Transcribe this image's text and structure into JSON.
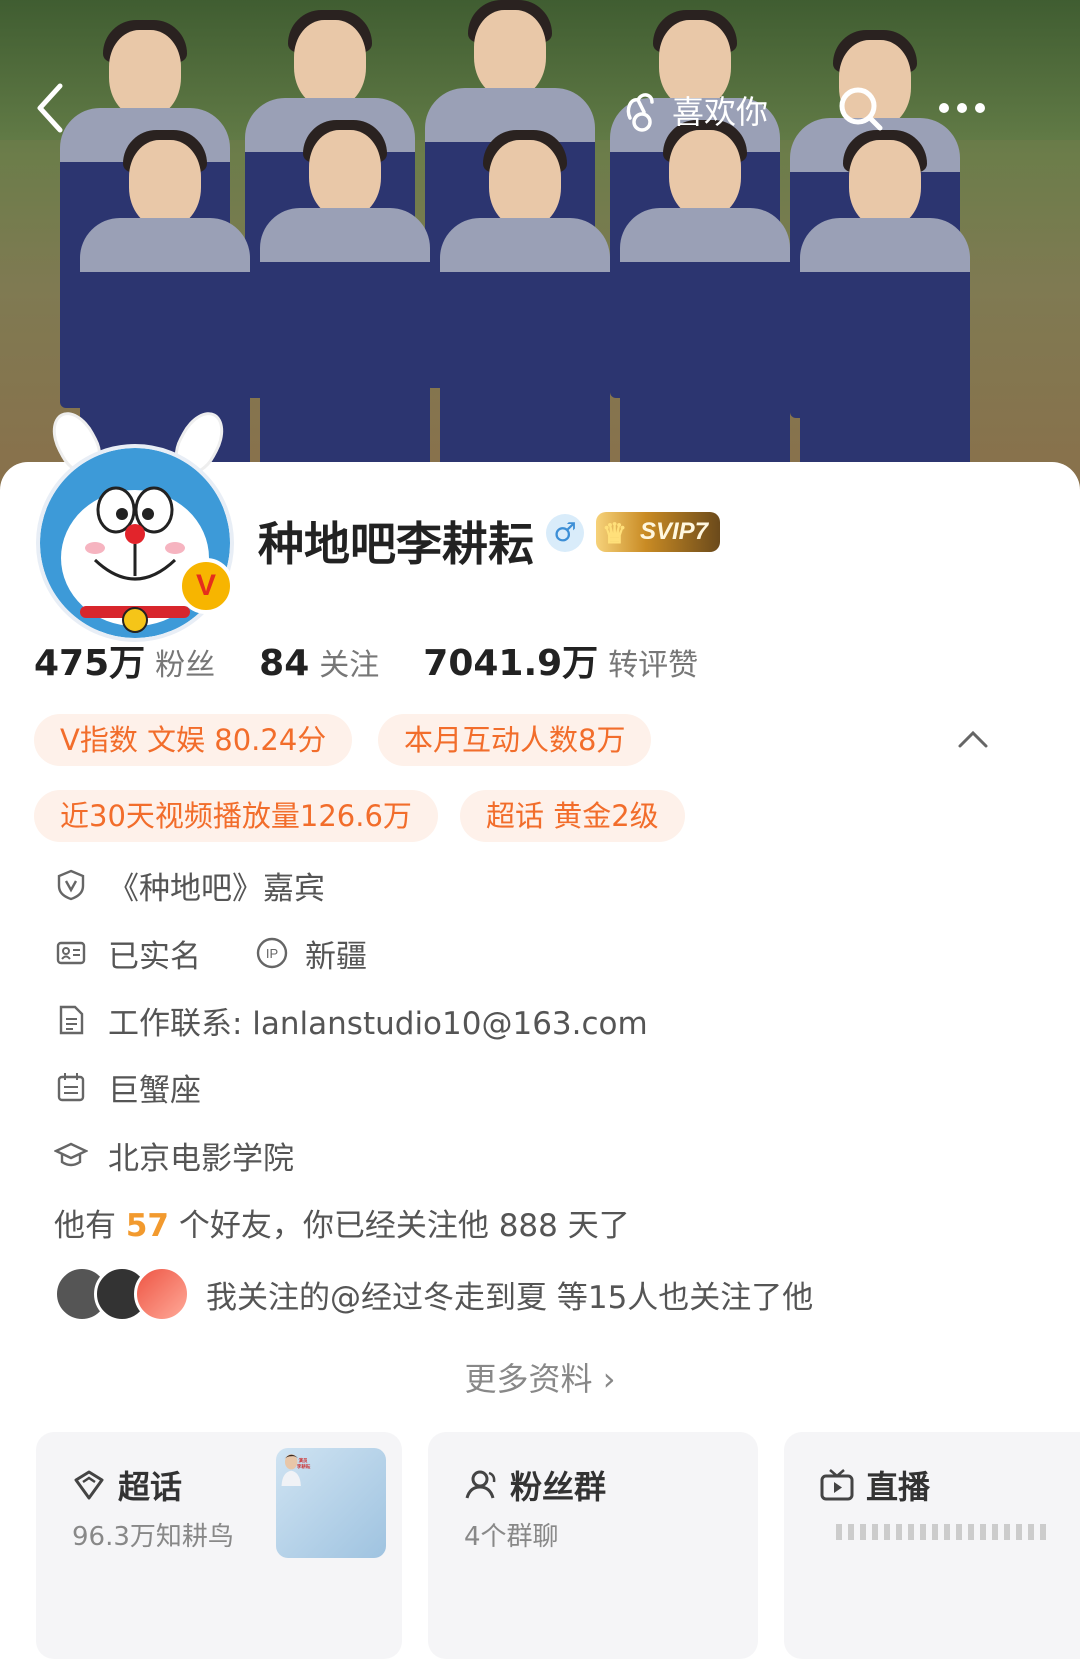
{
  "header": {
    "like_label": "喜欢你",
    "back_icon": "chevron-left-icon",
    "search_icon": "search-icon",
    "more_icon": "more-icon"
  },
  "profile": {
    "name": "种地吧李耕耘",
    "gender_symbol": "♂",
    "vip_label": "SVIP7",
    "verified_mark": "V"
  },
  "stats": [
    {
      "value": "475万",
      "label": "粉丝"
    },
    {
      "value": "84",
      "label": "关注"
    },
    {
      "value": "7041.9万",
      "label": "转评赞"
    }
  ],
  "tags": [
    "V指数 文娱 80.24分",
    "本月互动人数8万",
    "近30天视频播放量126.6万",
    "超话 黄金2级"
  ],
  "info": {
    "guest": "《种地吧》嘉宾",
    "real_name": "已实名",
    "ip_location": "新疆",
    "contact": "工作联系: lanlanstudio10@163.com",
    "zodiac": "巨蟹座",
    "school": "北京电影学院"
  },
  "friends": {
    "prefix": "他有",
    "count": "57",
    "suffix": "个好友，你已经关注他 888 天了"
  },
  "mutual": {
    "text": "我关注的@经过冬走到夏 等15人也关注了他"
  },
  "more_info": "更多资料",
  "bottom_cards": [
    {
      "title": "超话",
      "sub": "96.3万知耕鸟",
      "thumb_text": "演员\n李耕耘"
    },
    {
      "title": "粉丝群",
      "sub": "4个群聊"
    },
    {
      "title": "直播",
      "sub": ""
    }
  ],
  "colors": {
    "tag_bg": "#fef1ea",
    "tag_text": "#f26d2b",
    "highlight": "#f29a2e",
    "uniform": "#2c3570"
  }
}
